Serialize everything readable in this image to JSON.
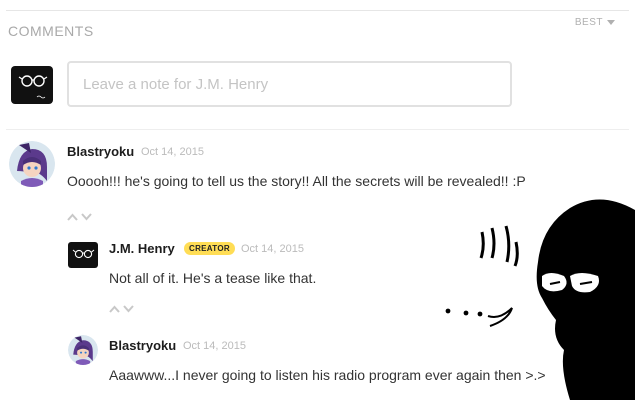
{
  "header": {
    "title": "COMMENTS",
    "sort_label": "BEST"
  },
  "composer": {
    "placeholder": "Leave a note for J.M. Henry"
  },
  "comments": [
    {
      "author": "Blastryoku",
      "date": "Oct 14, 2015",
      "text": "Ooooh!!! he's going to tell us the story!! All the secrets will be revealed!! :P"
    },
    {
      "author": "J.M. Henry",
      "badge": "CREATOR",
      "date": "Oct 14, 2015",
      "text": "Not all of it. He's a tease like that."
    },
    {
      "author": "Blastryoku",
      "date": "Oct 14, 2015",
      "text": "Aaawww...I never going to listen his radio program ever again then >.>"
    }
  ],
  "colors": {
    "badge": "#ffdd55",
    "meta_text": "#bbbbbb",
    "heading": "#a9a9a9"
  }
}
